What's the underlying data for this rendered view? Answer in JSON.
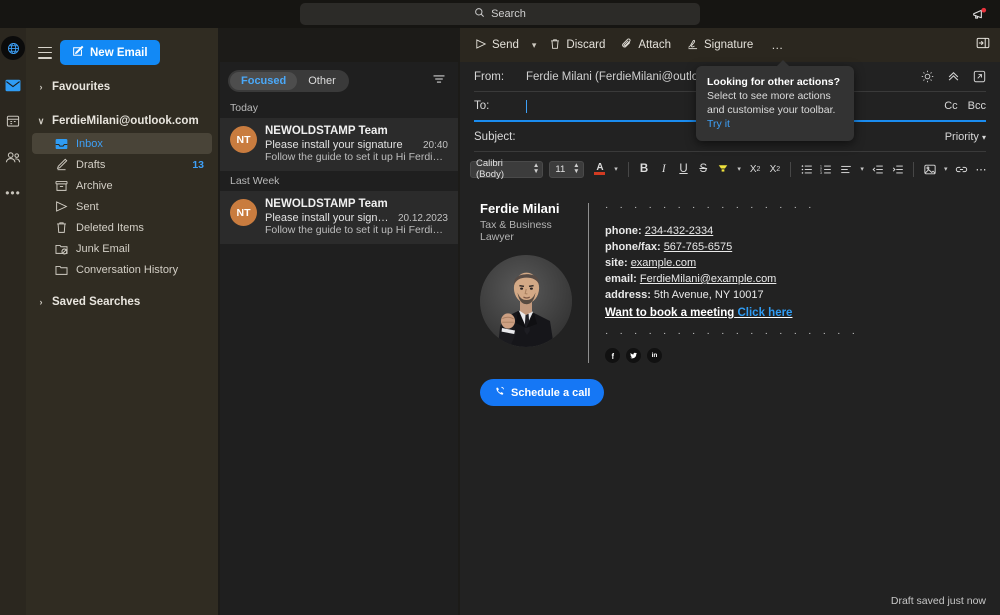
{
  "titlebar": {
    "search_placeholder": "Search",
    "search_icon": "search-icon",
    "megaphone_icon": "megaphone-icon"
  },
  "rail": {
    "items": [
      {
        "icon": "globe-icon",
        "name": "app-globe"
      },
      {
        "icon": "mail-icon",
        "name": "mail"
      },
      {
        "icon": "calendar-icon",
        "name": "calendar"
      },
      {
        "icon": "people-icon",
        "name": "people"
      },
      {
        "icon": "more-icon",
        "name": "more",
        "label": "•••"
      }
    ]
  },
  "sidebar": {
    "new_email_label": "New Email",
    "hamburger_icon": "hamburger-icon",
    "compose_icon": "compose-icon",
    "sections": [
      {
        "label": "Favourites",
        "chevron": "›"
      },
      {
        "label": "FerdieMilani@outlook.com",
        "chevron": "∨"
      },
      {
        "label": "Saved Searches",
        "chevron": "›"
      }
    ],
    "folders": [
      {
        "label": "Inbox",
        "icon": "inbox-icon",
        "count": "",
        "active": true
      },
      {
        "label": "Drafts",
        "icon": "drafts-icon",
        "count": "13",
        "active": false
      },
      {
        "label": "Archive",
        "icon": "archive-icon",
        "count": "",
        "active": false
      },
      {
        "label": "Sent",
        "icon": "sent-icon",
        "count": "",
        "active": false
      },
      {
        "label": "Deleted Items",
        "icon": "trash-icon",
        "count": "",
        "active": false
      },
      {
        "label": "Junk Email",
        "icon": "junk-icon",
        "count": "",
        "active": false
      },
      {
        "label": "Conversation History",
        "icon": "folder-icon",
        "count": "",
        "active": false
      }
    ]
  },
  "msglist": {
    "pivots": [
      {
        "label": "Focused",
        "selected": true
      },
      {
        "label": "Other",
        "selected": false
      }
    ],
    "filter_icon": "filter-icon",
    "groups": [
      {
        "label": "Today",
        "messages": [
          {
            "initials": "NT",
            "from": "NEWOLDSTAMP Team",
            "subject": "Please install your signature",
            "time": "20:40",
            "preview": "Follow the guide to set it up Hi Ferdie Mila…",
            "highlighted": true
          }
        ]
      },
      {
        "label": "Last Week",
        "messages": [
          {
            "initials": "NT",
            "from": "NEWOLDSTAMP Team",
            "subject": "Please install your signature",
            "time": "20.12.2023",
            "preview": "Follow the guide to set it up Hi Ferdie Mila…",
            "highlighted": true
          }
        ]
      }
    ]
  },
  "compose": {
    "toolbar": [
      {
        "label": "Send",
        "icon": "send-icon",
        "has_caret": true
      },
      {
        "label": "Discard",
        "icon": "trash-icon",
        "has_caret": false
      },
      {
        "label": "Attach",
        "icon": "paperclip-icon",
        "has_caret": false
      },
      {
        "label": "Signature",
        "icon": "signature-icon",
        "has_caret": false
      },
      {
        "label": "…",
        "icon": "ellipsis-icon",
        "has_caret": false
      }
    ],
    "expand_icon": "expand-pane-icon",
    "fields": {
      "from_label": "From:",
      "from_value": "Ferdie Milani (FerdieMilani@outlo",
      "to_label": "To:",
      "to_value": "",
      "cc_label": "Cc",
      "bcc_label": "Bcc",
      "subject_label": "Subject:",
      "subject_value": "",
      "priority_label": "Priority",
      "row_icons": [
        "brightness-icon",
        "collapse-icon",
        "popout-icon"
      ]
    },
    "format_bar": {
      "font_family": "Calibri (Body)",
      "font_size": "11",
      "items": [
        "font-color-icon",
        "font-color-caret",
        "bold-icon",
        "italic-icon",
        "underline-icon",
        "strikethrough-icon",
        "highlight-icon",
        "highlight-caret",
        "superscript-icon",
        "subscript-icon",
        "bulleted-list-icon",
        "numbered-list-icon",
        "align-icon",
        "align-caret",
        "decrease-indent-icon",
        "increase-indent-icon",
        "insert-picture-icon",
        "insert-picture-caret",
        "link-icon",
        "more-format-icon"
      ]
    },
    "draft_status": "Draft saved just now"
  },
  "tooltip": {
    "title": "Looking for other actions?",
    "body": "Select to see more actions and customise your toolbar.",
    "link": "Try it"
  },
  "signature": {
    "name": "Ferdie Milani",
    "title": "Tax & Business Lawyer",
    "photo_alt": "portrait-photo",
    "rows": [
      {
        "label": "phone:",
        "value": "234-432-2334",
        "link": true,
        "blue": false
      },
      {
        "label": "phone/fax:",
        "value": "567-765-6575",
        "link": true,
        "blue": false
      },
      {
        "label": "site:",
        "value": "example.com",
        "link": true,
        "blue": false
      },
      {
        "label": "email:",
        "value": "FerdieMilani@example.com",
        "link": true,
        "blue": false
      },
      {
        "label": "address:",
        "value": "5th Avenue, NY 10017",
        "link": false,
        "blue": false
      }
    ],
    "cta_text": "Want to book a meeting",
    "cta_link": "Click here",
    "socials": [
      {
        "icon": "facebook-icon",
        "glyph": "f"
      },
      {
        "icon": "twitter-icon",
        "glyph": "t"
      },
      {
        "icon": "linkedin-icon",
        "glyph": "in"
      }
    ],
    "button_label": "Schedule a call",
    "button_icon": "phone-ring-icon"
  },
  "colors": {
    "accent_blue": "#1289f5",
    "sidebar_bg": "#302c22",
    "compose_bg": "#222222",
    "avatar_orange": "#c97c3f",
    "link_blue": "#2f9cf4"
  }
}
